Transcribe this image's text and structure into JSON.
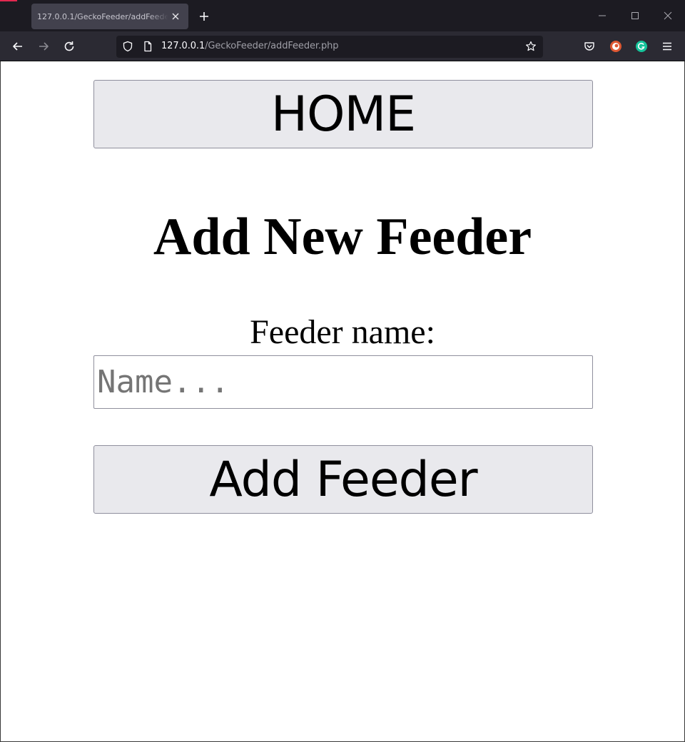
{
  "browser": {
    "tab_title": "127.0.0.1/GeckoFeeder/addFeeder.php",
    "url_host": "127.0.0.1",
    "url_path": "/GeckoFeeder/addFeeder.php",
    "icons": [
      "back-icon",
      "forward-icon",
      "reload-icon",
      "shield-icon",
      "page-icon",
      "bookmark-star-icon",
      "pocket-icon",
      "duckduckgo-icon",
      "grammarly-icon",
      "menu-icon"
    ],
    "colors": {
      "titlebar": "#1c1b22",
      "toolbar": "#2b2a33",
      "tab": "#42414d",
      "urlbar": "#1c1b22"
    }
  },
  "page": {
    "home_label": "HOME",
    "title": "Add New Feeder",
    "feeder_name_label": "Feeder name:",
    "name_input": {
      "placeholder": "Name...",
      "value": ""
    },
    "submit_label": "Add Feeder",
    "colors": {
      "button_bg": "#e9e9ed",
      "button_border": "#8f8f9d"
    }
  }
}
